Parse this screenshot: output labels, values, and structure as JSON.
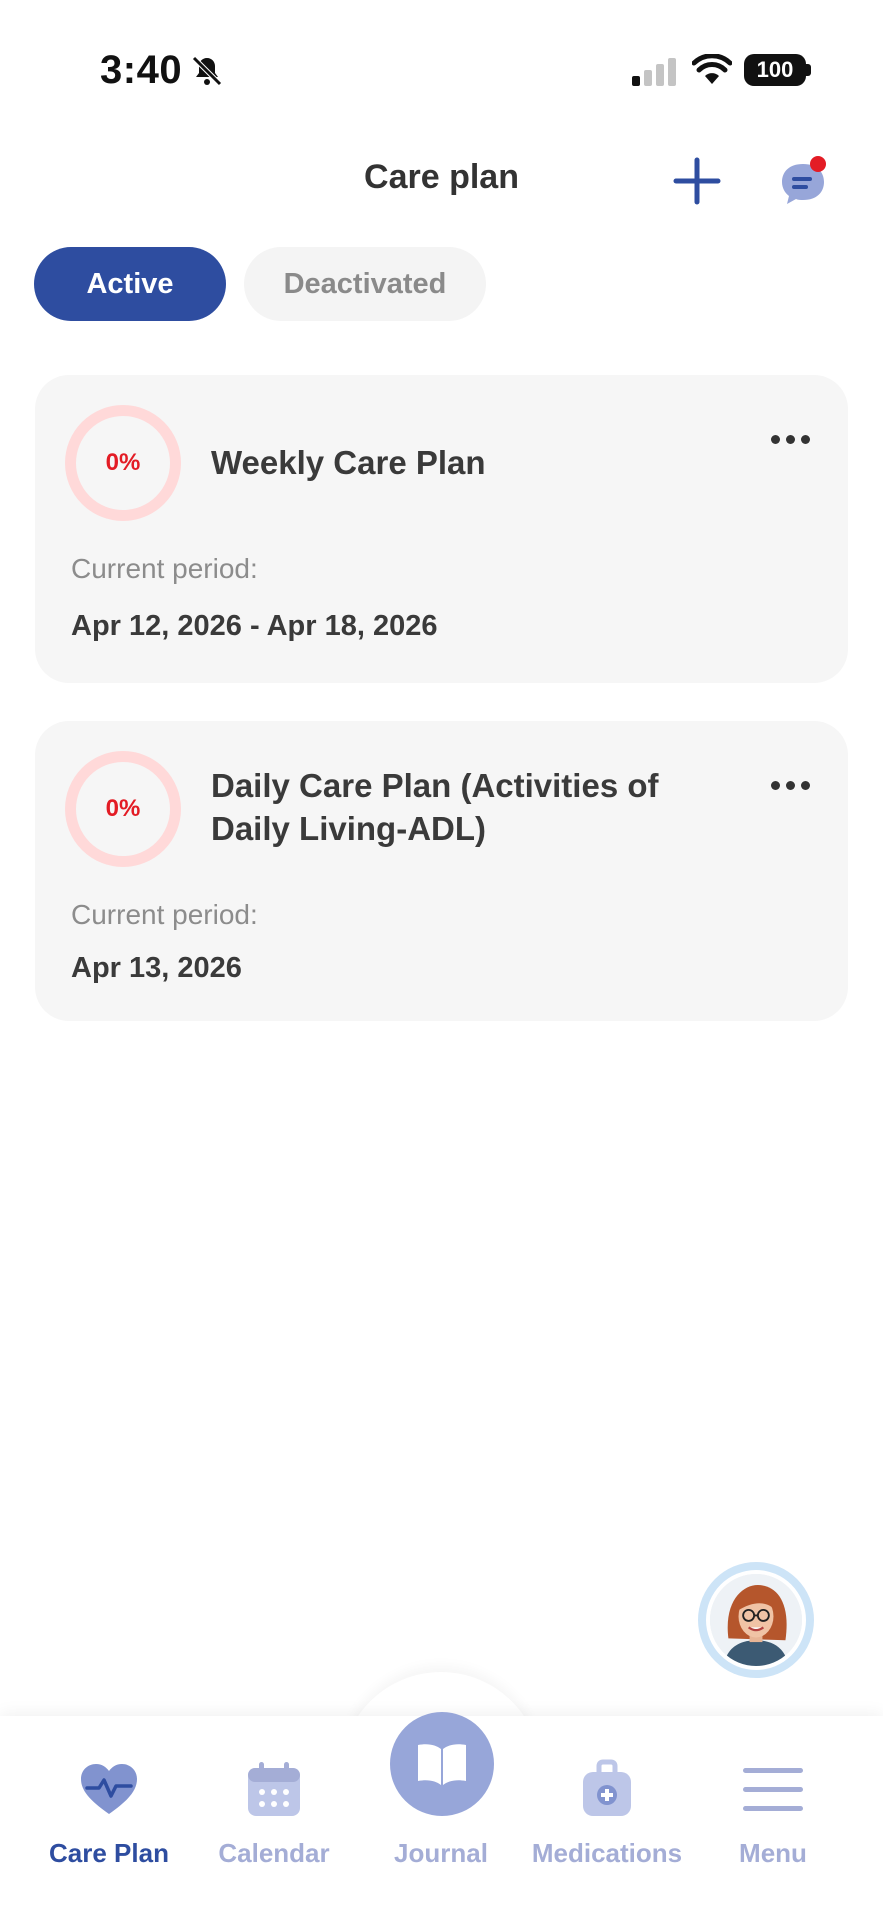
{
  "status_bar": {
    "time": "3:40",
    "battery": "100",
    "icons": [
      "bell-slash-icon",
      "signal-icon",
      "wifi-icon",
      "battery-icon"
    ]
  },
  "header": {
    "title": "Care plan",
    "icons": [
      "plus-icon",
      "chat-icon"
    ]
  },
  "tabs": [
    {
      "label": "Active",
      "selected": true
    },
    {
      "label": "Deactivated",
      "selected": false
    }
  ],
  "care_plans": [
    {
      "progress": "0%",
      "title": "Weekly Care Plan",
      "period_label": "Current period:",
      "period_value": "Apr 12, 2026 - Apr 18, 2026"
    },
    {
      "progress": "0%",
      "title": "Daily Care Plan (Activities of Daily Living-ADL)",
      "period_label": "Current period:",
      "period_value": "Apr 13, 2026"
    }
  ],
  "bottom_nav": [
    {
      "label": "Care Plan",
      "icon": "heart-pulse-icon",
      "active": true
    },
    {
      "label": "Calendar",
      "icon": "calendar-icon",
      "active": false
    },
    {
      "label": "Journal",
      "icon": "book-icon",
      "active": false
    },
    {
      "label": "Medications",
      "icon": "medical-bag-icon",
      "active": false
    },
    {
      "label": "Menu",
      "icon": "hamburger-menu-icon",
      "active": false
    }
  ],
  "colors": {
    "accent": "#2e4da0",
    "inactive_nav": "#a4add6",
    "progress_text": "#e31c25",
    "progress_ring": "#ffd9d9",
    "notification_dot": "#e31c25"
  }
}
